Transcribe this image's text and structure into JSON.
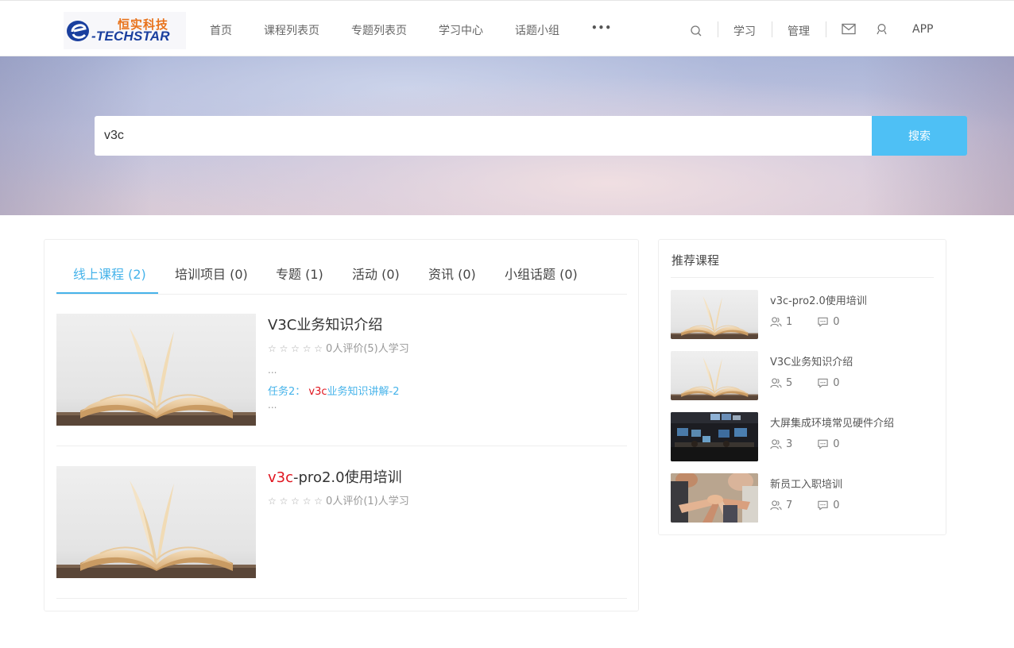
{
  "header": {
    "logo_cn": "恒实科技",
    "logo_en": "-TECHSTAR",
    "nav": [
      "首页",
      "课程列表页",
      "专题列表页",
      "学习中心",
      "话题小组"
    ],
    "more_label": "•••",
    "tools": {
      "learn": "学习",
      "manage": "管理",
      "app": "APP"
    }
  },
  "search": {
    "value": "v3c",
    "button": "搜索"
  },
  "tabs": [
    "线上课程 (2)",
    "培训项目 (0)",
    "专题 (1)",
    "活动 (0)",
    "资讯 (0)",
    "小组话题 (0)"
  ],
  "courses": [
    {
      "title_hl": "",
      "title_rest": "V3C业务知识介绍",
      "stars": "☆ ☆ ☆ ☆ ☆",
      "rating_text": "0人评价(5)人学习",
      "ellipsis": "...",
      "task_prefix": "任务2： ",
      "task_hl": "v3c",
      "task_rest": "业务知识讲解-2"
    },
    {
      "title_hl": "v3c",
      "title_rest": "-pro2.0使用培训",
      "stars": "☆ ☆ ☆ ☆ ☆",
      "rating_text": "0人评价(1)人学习"
    }
  ],
  "sidebar": {
    "title": "推荐课程",
    "items": [
      {
        "title": "v3c-pro2.0使用培训",
        "students": "1",
        "comments": "0",
        "image": "book"
      },
      {
        "title": "V3C业务知识介绍",
        "students": "5",
        "comments": "0",
        "image": "book"
      },
      {
        "title": "大屏集成环境常见硬件介绍",
        "students": "3",
        "comments": "0",
        "image": "control-room"
      },
      {
        "title": "新员工入职培训",
        "students": "7",
        "comments": "0",
        "image": "team-hands"
      }
    ]
  },
  "colors": {
    "accent": "#46b3ea",
    "search_button": "#4ec0f5",
    "highlight": "#e0141e",
    "logo_orange": "#e8731c",
    "logo_blue": "#1a3f9e"
  }
}
